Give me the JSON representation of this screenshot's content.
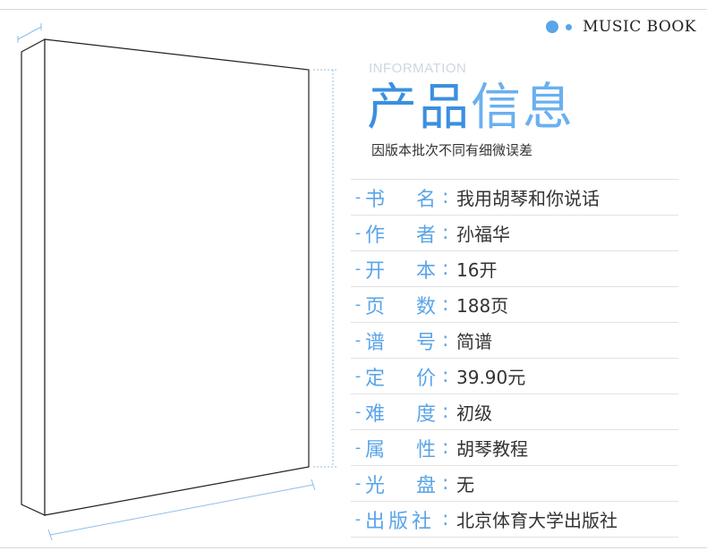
{
  "brand": {
    "text": "MUSIC BOOK"
  },
  "header": {
    "subtitle_en": "INFORMATION",
    "title_part1": "产品",
    "title_part2": "信息",
    "note": "因版本批次不同有细微误差"
  },
  "info": [
    {
      "label": "书 名",
      "value": "我用胡琴和你说话"
    },
    {
      "label": "作 者",
      "value": "孙福华"
    },
    {
      "label": "开 本",
      "value": "16开"
    },
    {
      "label": "页 数",
      "value": "188页"
    },
    {
      "label": "谱 号",
      "value": "简谱"
    },
    {
      "label": "定 价",
      "value": "39.90元"
    },
    {
      "label": "难 度",
      "value": "初级"
    },
    {
      "label": "属 性",
      "value": "胡琴教程"
    },
    {
      "label": "光 盘",
      "value": "无"
    },
    {
      "label": "出版社",
      "value": "北京体育大学出版社"
    }
  ],
  "colors": {
    "accent": "#5aa4e8",
    "title": "#3b8fe0",
    "text": "#333333",
    "rule": "#e2e2e2"
  }
}
